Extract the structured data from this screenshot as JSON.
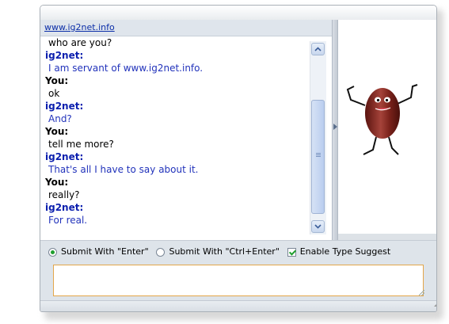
{
  "link_bar": {
    "site_link": "www.ig2net.info"
  },
  "chat": {
    "messages": [
      {
        "speaker": "",
        "text": "who are you?",
        "role": "you"
      },
      {
        "speaker": "ig2net:",
        "text": "I am servant of www.ig2net.info.",
        "role": "bot"
      },
      {
        "speaker": "You:",
        "text": "ok",
        "role": "you"
      },
      {
        "speaker": "ig2net:",
        "text": "And?",
        "role": "bot"
      },
      {
        "speaker": "You:",
        "text": "tell me more?",
        "role": "you"
      },
      {
        "speaker": "ig2net:",
        "text": "That's all I have to say about it.",
        "role": "bot"
      },
      {
        "speaker": "You:",
        "text": "really?",
        "role": "you"
      },
      {
        "speaker": "ig2net:",
        "text": "For real.",
        "role": "bot"
      }
    ]
  },
  "options": {
    "submit_enter": {
      "label": "Submit With \"Enter\"",
      "selected": true
    },
    "submit_ctrl_enter": {
      "label": "Submit With \"Ctrl+Enter\"",
      "selected": false
    },
    "type_suggest": {
      "label": "Enable Type Suggest",
      "checked": true
    }
  },
  "input": {
    "value": ""
  },
  "colors": {
    "bot_speaker": "#0b1fae",
    "bot_text": "#2233bb",
    "accent_green": "#1f9f2f",
    "input_border": "#e3a64a",
    "avatar_body": "#8a2a22"
  },
  "icons": {
    "scroll_up": "chevron-up-icon",
    "scroll_down": "chevron-down-icon",
    "splitter": "caret-right-icon",
    "avatar": "bean-character-icon"
  }
}
